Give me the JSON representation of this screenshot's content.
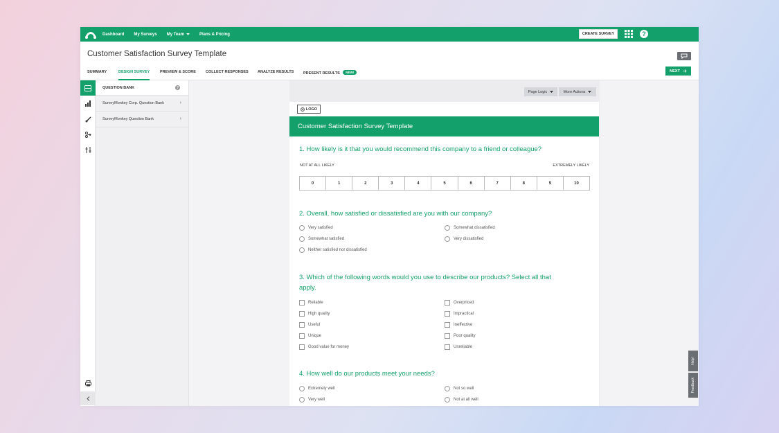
{
  "nav": {
    "links": [
      "Dashboard",
      "My Surveys",
      "My Team",
      "Plans & Pricing"
    ],
    "create_survey": "CREATE SURVEY"
  },
  "survey": {
    "title": "Customer Satisfaction Survey Template"
  },
  "tabs": {
    "summary": "SUMMARY",
    "design": "DESIGN SURVEY",
    "preview": "PREVIEW & SCORE",
    "collect": "COLLECT RESPONSES",
    "analyze": "ANALYZE RESULTS",
    "present": "PRESENT RESULTS",
    "new_badge": "NEW!",
    "next": "NEXT"
  },
  "question_bank": {
    "header": "QUESTION BANK",
    "items": [
      "SurveyMonkey Corp. Question Bank",
      "SurveyMonkey Question Bank"
    ]
  },
  "toolbar": {
    "page_logic": "Page Logic",
    "more_actions": "More Actions"
  },
  "card": {
    "logo": "LOGO",
    "banner": "Customer Satisfaction Survey Template",
    "q1": {
      "title": "1. How likely is it that you would recommend this company to a friend or colleague?",
      "low": "NOT AT ALL LIKELY",
      "high": "EXTREMELY LIKELY",
      "scale": [
        "0",
        "1",
        "2",
        "3",
        "4",
        "5",
        "6",
        "7",
        "8",
        "9",
        "10"
      ]
    },
    "q2": {
      "title": "2. Overall, how satisfied or dissatisfied are you with our company?",
      "options": [
        "Very satisfied",
        "Somewhat satisfied",
        "Neither satisfied nor dissatisfied",
        "Somewhat dissatisfied",
        "Very dissatisfied"
      ]
    },
    "q3": {
      "title_line1": "3. Which of the following words would you use to describe our products? Select all that",
      "title_line2": "apply.",
      "left": [
        "Reliable",
        "High quality",
        "Useful",
        "Unique",
        "Good value for money"
      ],
      "right": [
        "Overpriced",
        "Impractical",
        "Ineffective",
        "Poor quality",
        "Unreliable"
      ]
    },
    "q4": {
      "title": "4. How well do our products meet your needs?",
      "left": [
        "Extremely well",
        "Very well"
      ],
      "right": [
        "Not so well",
        "Not at all well"
      ]
    }
  },
  "side_tabs": {
    "help": "Help!",
    "feedback": "Feedback"
  },
  "colors": {
    "brand": "#14a06a"
  }
}
